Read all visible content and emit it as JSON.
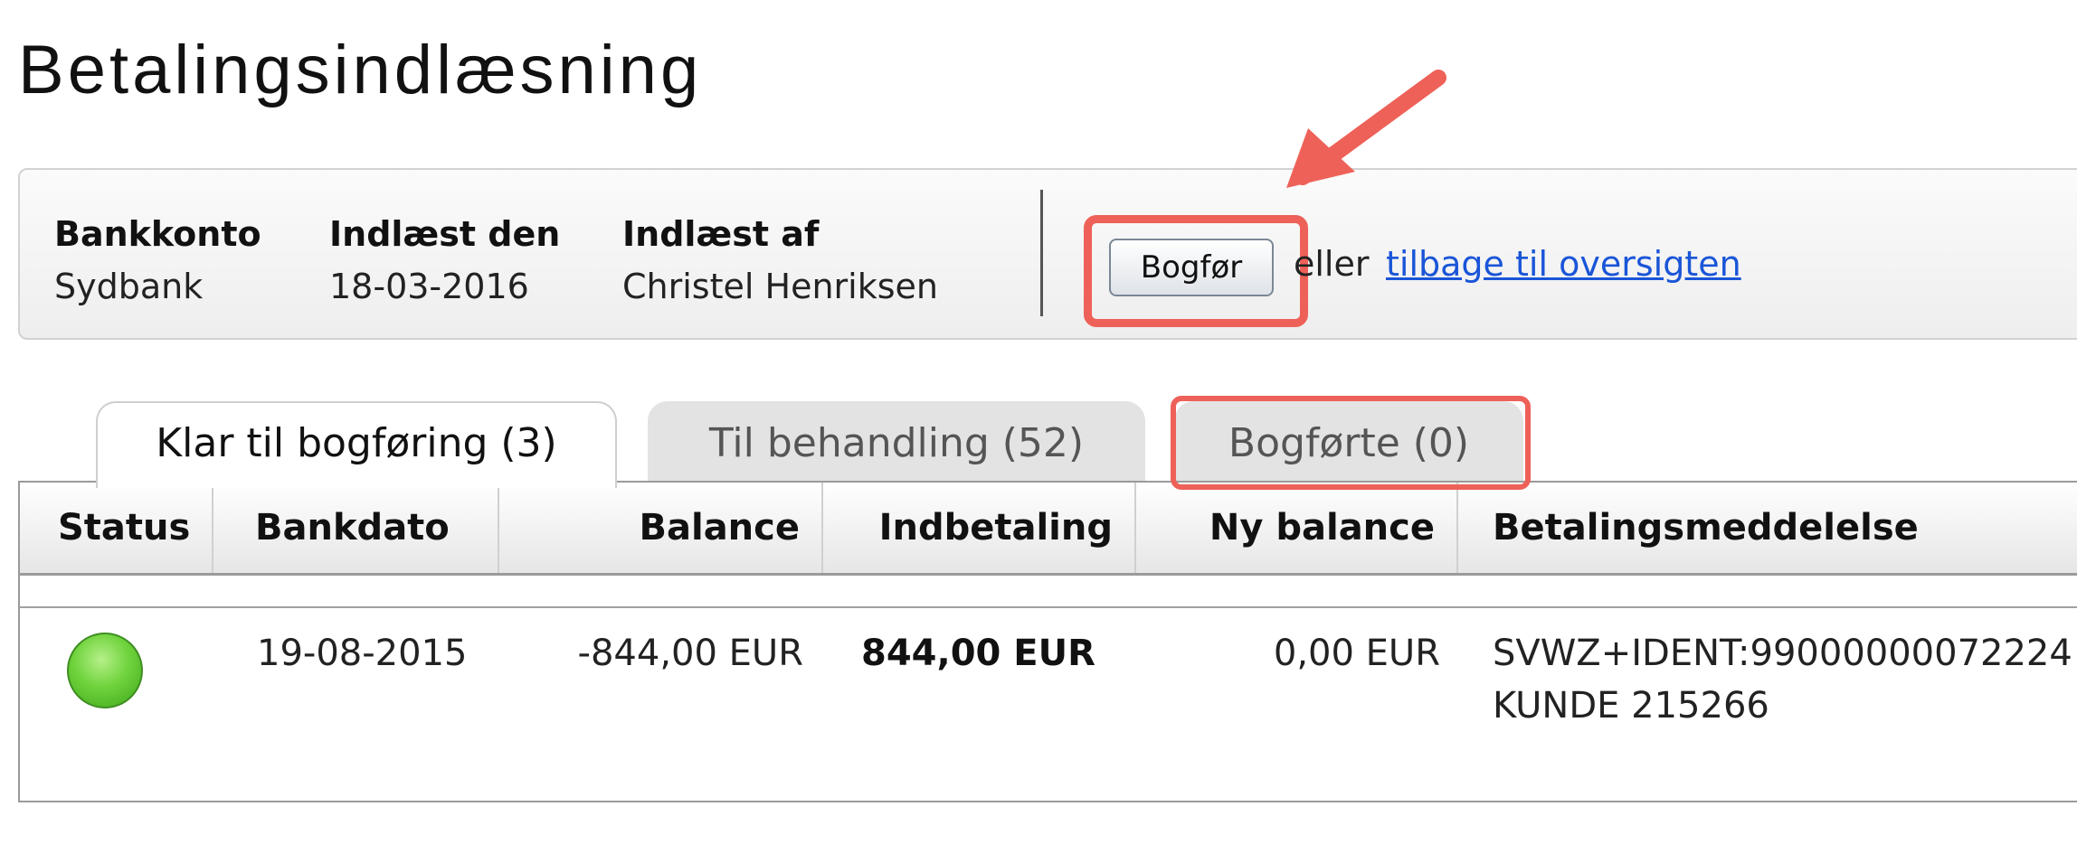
{
  "page": {
    "title": "Betalingsindlæsning"
  },
  "info": {
    "bank_account_label": "Bankkonto",
    "bank_account_value": "Sydbank",
    "read_date_label": "Indlæst den",
    "read_date_value": "18-03-2016",
    "read_by_label": "Indlæst af",
    "read_by_value": "Christel Henriksen"
  },
  "actions": {
    "post_label": "Bogfør",
    "or_text": "eller",
    "back_link": "tilbage til oversigten"
  },
  "tabs": [
    {
      "label": "Klar til bogføring (3)",
      "active": true
    },
    {
      "label": "Til behandling (52)",
      "active": false
    },
    {
      "label": "Bogførte (0)",
      "active": false
    }
  ],
  "table": {
    "headers": [
      "Status",
      "Bankdato",
      "Balance",
      "Indbetaling",
      "Ny balance",
      "Betalingsmeddelelse"
    ],
    "rows": [
      {
        "status": "green",
        "bankdato": "19-08-2015",
        "balance": "-844,00 EUR",
        "indbetaling": "844,00 EUR",
        "ny_balance": "0,00 EUR",
        "message_line1": "SVWZ+IDENT:99000000072224",
        "message_line2": "KUNDE 215266"
      }
    ]
  },
  "colors": {
    "highlight": "#ee6158",
    "link": "#1a55d8",
    "status_ok": "#6fd33c"
  },
  "icons": {
    "status": "green-status-dot-icon",
    "annotation": "red-arrow-icon"
  }
}
